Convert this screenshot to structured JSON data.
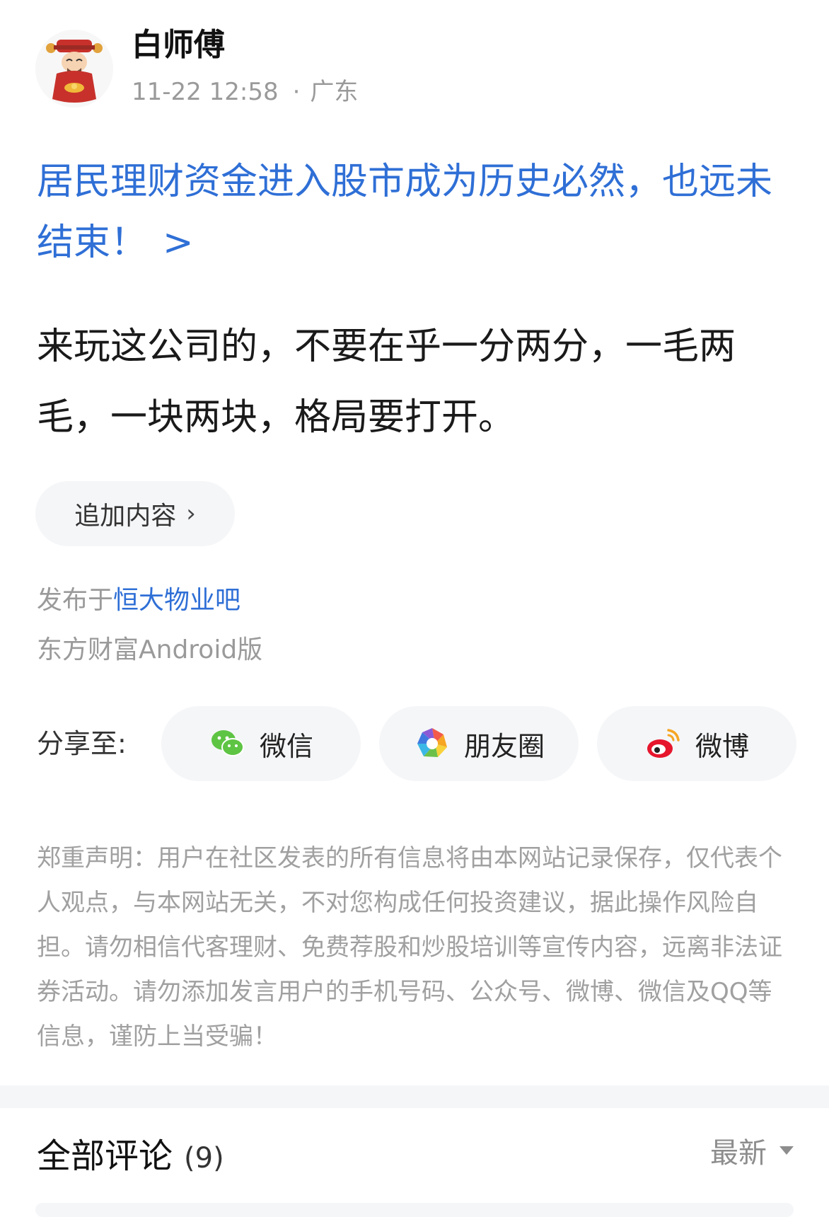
{
  "author": {
    "name": "白师傅",
    "time": "11-22 12:58",
    "separator": "·",
    "location": "广东",
    "avatar_icon": "god-of-wealth-avatar"
  },
  "post": {
    "title": "居民理财资金进入股市成为历史必然，也远未结束！",
    "title_arrow": ">",
    "content": "来玩这公司的，不要在乎一分两分，一毛两毛，一块两块，格局要打开。",
    "add_content_label": "追加内容",
    "add_content_chevron": "›",
    "published_prefix": "发布于",
    "forum": "恒大物业吧",
    "client": "东方财富Android版"
  },
  "share": {
    "label": "分享至:",
    "targets": [
      {
        "label": "微信",
        "icon": "wechat-icon"
      },
      {
        "label": "朋友圈",
        "icon": "moments-icon"
      },
      {
        "label": "微博",
        "icon": "weibo-icon"
      }
    ]
  },
  "disclaimer": "郑重声明：用户在社区发表的所有信息将由本网站记录保存，仅代表个人观点，与本网站无关，不对您构成任何投资建议，据此操作风险自担。请勿相信代客理财、免费荐股和炒股培训等宣传内容，远离非法证券活动。请勿添加发言用户的手机号码、公众号、微博、微信及QQ等信息，谨防上当受骗！",
  "comments": {
    "title": "全部评论",
    "count": "(9)",
    "sort_label": "最新"
  },
  "colors": {
    "link": "#2f6fd6",
    "muted": "#9a9a9a",
    "pill_bg": "#f5f6f8"
  }
}
